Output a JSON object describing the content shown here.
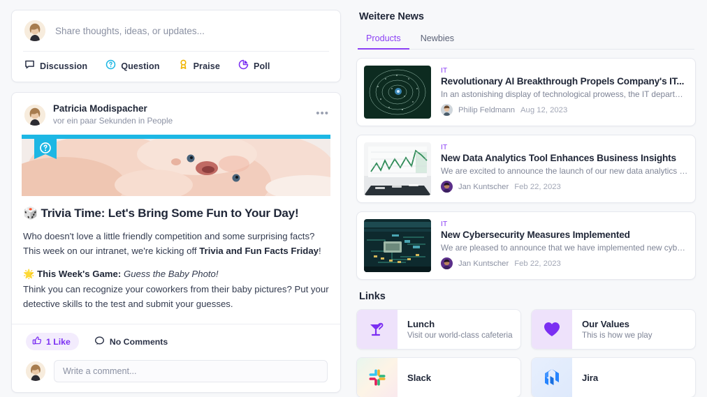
{
  "composer": {
    "placeholder": "Share thoughts, ideas, or updates...",
    "avatar_name": "user-avatar",
    "actions": [
      {
        "label": "Discussion",
        "icon": "speech-bubble-icon",
        "color": "#2b3247"
      },
      {
        "label": "Question",
        "icon": "question-circle-icon",
        "color": "#1db7e4"
      },
      {
        "label": "Praise",
        "icon": "award-ribbon-icon",
        "color": "#f0b400"
      },
      {
        "label": "Poll",
        "icon": "pie-chart-icon",
        "color": "#7b2ff2"
      }
    ]
  },
  "post": {
    "author": "Patricia Modispacher",
    "meta": "vor ein paar Sekunden in People",
    "more_label": "•••",
    "badge_icon": "question-badge-icon",
    "badge_color": "#1db7e4",
    "title": "🎲 Trivia Time: Let's Bring Some Fun to Your Day!",
    "paragraph1_a": "Who doesn't love a little friendly competition and some surprising facts? This week on our intranet, we're kicking off ",
    "paragraph1_b": "Trivia and Fun Facts Friday",
    "paragraph1_c": "!",
    "game_emoji": "🌟",
    "game_label": "This Week's Game:",
    "game_value": "Guess the Baby Photo!",
    "paragraph2": "Think you can recognize your coworkers from their baby pictures? Put your detective skills to the test and submit your guesses.",
    "like_label": "1 Like",
    "like_icon": "thumbs-up-icon",
    "comment_label": "No Comments",
    "comment_icon": "comment-bubble-icon",
    "comment_placeholder": "Write a comment..."
  },
  "news": {
    "heading": "Weitere News",
    "tabs": [
      {
        "label": "Products",
        "active": true
      },
      {
        "label": "Newbies",
        "active": false
      }
    ],
    "items": [
      {
        "category": "IT",
        "title": "Revolutionary AI Breakthrough Propels Company's IT...",
        "excerpt": "In an astonishing display of technological prowess, the IT department at [Yo...",
        "author": "Philip Feldmann",
        "date": "Aug 12, 2023",
        "thumb": "ai-network-thumbnail"
      },
      {
        "category": "IT",
        "title": "New Data Analytics Tool Enhances Business Insights",
        "excerpt": "We are excited to announce the launch of our new data analytics tool, which...",
        "author": "Jan Kuntscher",
        "date": "Feb 22, 2023",
        "thumb": "analytics-chart-thumbnail"
      },
      {
        "category": "IT",
        "title": "New Cybersecurity Measures Implemented",
        "excerpt": "We are pleased to announce that we have implemented new cybersecurity...",
        "author": "Jan Kuntscher",
        "date": "Feb 22, 2023",
        "thumb": "circuit-board-thumbnail"
      }
    ]
  },
  "links": {
    "heading": "Links",
    "items": [
      {
        "name": "Lunch",
        "sub": "Visit our world-class cafeteria",
        "icon": "cocktail-glass-icon"
      },
      {
        "name": "Our Values",
        "sub": "This is how we play",
        "icon": "heart-icon"
      },
      {
        "name": "Slack",
        "sub": "",
        "icon": "slack-icon"
      },
      {
        "name": "Jira",
        "sub": "",
        "icon": "jira-icon"
      }
    ]
  },
  "colors": {
    "accent_purple": "#8b3ff5",
    "accent_cyan": "#1db7e4",
    "page_bg": "#f7f8fa"
  }
}
